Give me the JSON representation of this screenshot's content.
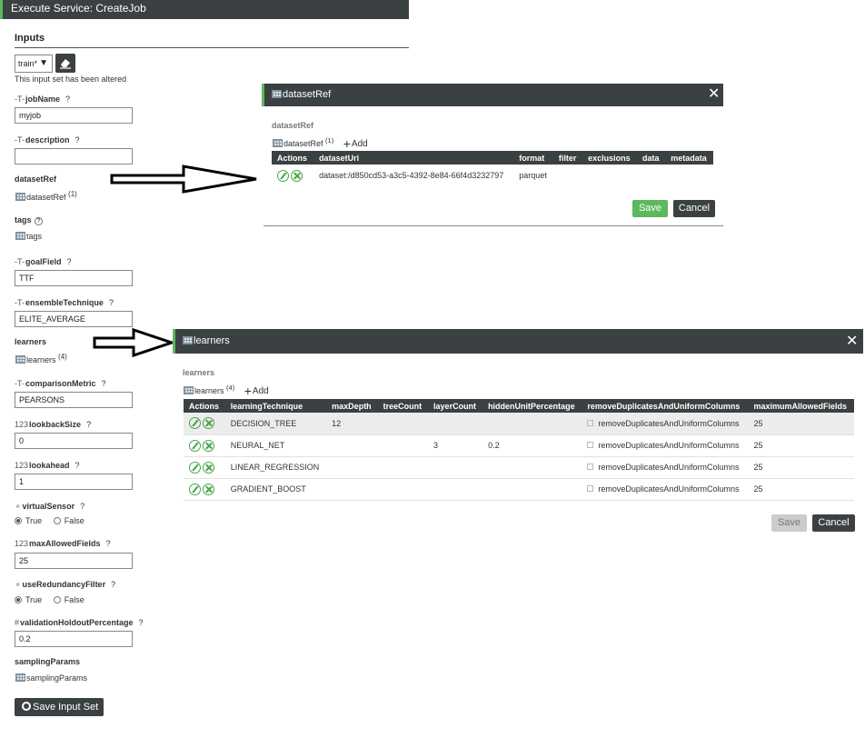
{
  "window": {
    "title": "Execute Service: CreateJob"
  },
  "inputs": {
    "heading": "Inputs",
    "preset": {
      "value": "train*"
    },
    "altered_note": "This input set has been altered",
    "fields": {
      "jobName": {
        "prefix": "-T-",
        "label": "jobName",
        "help": "?",
        "value": "myjob"
      },
      "description": {
        "prefix": "-T-",
        "label": "description",
        "help": "?",
        "value": ""
      },
      "datasetRef": {
        "label": "datasetRef",
        "link": "datasetRef",
        "count": "(1)"
      },
      "tags": {
        "label": "tags",
        "help": "?",
        "link": "tags"
      },
      "goalField": {
        "prefix": "-T-",
        "label": "goalField",
        "help": "?",
        "value": "TTF"
      },
      "ensembleTechnique": {
        "prefix": "-T-",
        "label": "ensembleTechnique",
        "help": "?",
        "value": "ELITE_AVERAGE"
      },
      "learners": {
        "label": "learners",
        "link": "learners",
        "count": "(4)"
      },
      "comparisonMetric": {
        "prefix": "-T-",
        "label": "comparisonMetric",
        "help": "?",
        "value": "PEARSONS"
      },
      "lookbackSize": {
        "prefix": "123",
        "label": "lookbackSize",
        "help": "?",
        "value": "0"
      },
      "lookahead": {
        "prefix": "123",
        "label": "lookahead",
        "help": "?",
        "value": "1"
      },
      "virtualSensor": {
        "label": "virtualSensor",
        "help": "?",
        "true_label": "True",
        "false_label": "False",
        "selected": "True"
      },
      "maxAllowedFields": {
        "prefix": "123",
        "label": "maxAllowedFields",
        "help": "?",
        "value": "25"
      },
      "useRedundancyFilter": {
        "label": "useRedundancyFilter",
        "help": "?",
        "true_label": "True",
        "false_label": "False",
        "selected": "True"
      },
      "validationHoldoutPercentage": {
        "prefix": "#",
        "label": "validationHoldoutPercentage",
        "help": "?",
        "value": "0.2"
      },
      "samplingParams": {
        "label": "samplingParams",
        "link": "samplingParams"
      }
    },
    "save_input_set": "Save Input Set"
  },
  "dataset_dialog": {
    "title": "datasetRef",
    "close": "✕",
    "section_label": "datasetRef",
    "link": "datasetRef",
    "count": "(1)",
    "add_label": "Add",
    "columns": [
      "Actions",
      "datasetUri",
      "format",
      "filter",
      "exclusions",
      "data",
      "metadata"
    ],
    "rows": [
      {
        "datasetUri": "dataset:/d850cd53-a3c5-4392-8e84-66f4d3232797",
        "format": "parquet",
        "filter": "",
        "exclusions": "",
        "data": "",
        "metadata": ""
      }
    ],
    "save": "Save",
    "cancel": "Cancel"
  },
  "learners_dialog": {
    "title": "learners",
    "close": "✕",
    "section_label": "learners",
    "link": "learners",
    "count": "(4)",
    "add_label": "Add",
    "columns": [
      "Actions",
      "learningTechnique",
      "maxDepth",
      "treeCount",
      "layerCount",
      "hiddenUnitPercentage",
      "removeDuplicatesAndUniformColumns",
      "maximumAllowedFields"
    ],
    "rows": [
      {
        "learningTechnique": "DECISION_TREE",
        "maxDepth": "12",
        "treeCount": "",
        "layerCount": "",
        "hiddenUnitPercentage": "",
        "removeDuplicates": "removeDuplicatesAndUniformColumns",
        "maximumAllowedFields": "25"
      },
      {
        "learningTechnique": "NEURAL_NET",
        "maxDepth": "",
        "treeCount": "",
        "layerCount": "3",
        "hiddenUnitPercentage": "0.2",
        "removeDuplicates": "removeDuplicatesAndUniformColumns",
        "maximumAllowedFields": "25"
      },
      {
        "learningTechnique": "LINEAR_REGRESSION",
        "maxDepth": "",
        "treeCount": "",
        "layerCount": "",
        "hiddenUnitPercentage": "",
        "removeDuplicates": "removeDuplicatesAndUniformColumns",
        "maximumAllowedFields": "25"
      },
      {
        "learningTechnique": "GRADIENT_BOOST",
        "maxDepth": "",
        "treeCount": "",
        "layerCount": "",
        "hiddenUnitPercentage": "",
        "removeDuplicates": "removeDuplicatesAndUniformColumns",
        "maximumAllowedFields": "25"
      }
    ],
    "save": "Save",
    "cancel": "Cancel"
  },
  "colors": {
    "header": "#3b4142",
    "accent": "#5cb85c"
  }
}
